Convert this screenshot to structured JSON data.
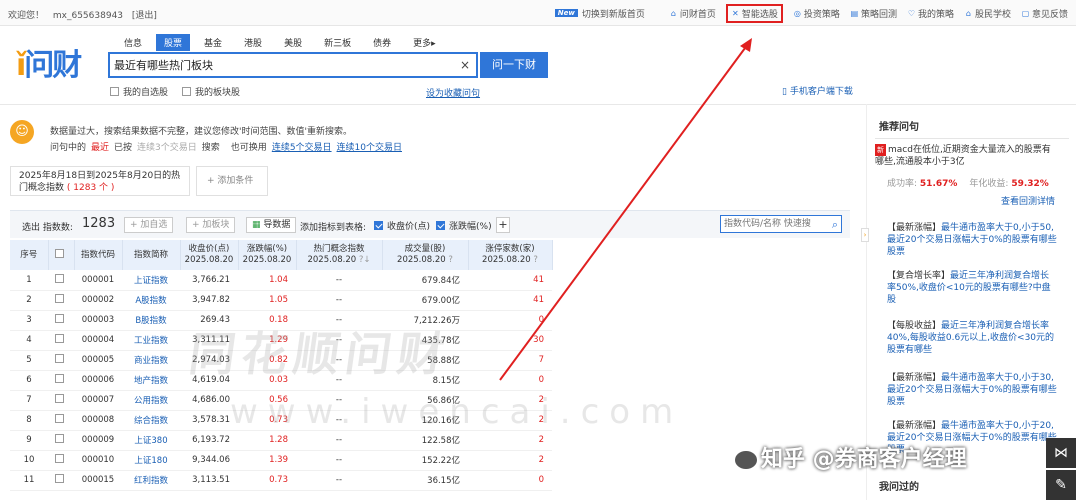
{
  "topbar": {
    "welcome": "欢迎您！",
    "user": "mx_655638943",
    "logout": "[退出]",
    "new_badge": "New",
    "switch_new": "切换到新版首页",
    "links": [
      "问财首页",
      "智能选股",
      "投资策略",
      "策略回测",
      "我的策略",
      "股民学校",
      "意见反馈"
    ]
  },
  "logo": {
    "text": "问财"
  },
  "tabs": [
    "信息",
    "股票",
    "基金",
    "港股",
    "美股",
    "新三板",
    "债券",
    "更多▸"
  ],
  "search": {
    "value": "最近有哪些热门板块",
    "clear": "×",
    "button": "问一下财"
  },
  "checks": {
    "my_stocks": "我的自选股",
    "my_sectors": "我的板块股"
  },
  "fav_link": "设为收藏问句",
  "mobile_link": "手机客户端下载",
  "notice": {
    "line1": "数据量过大，搜索结果数据不完整，建议您修改'时间范围、数值'重新搜索。",
    "l2_prefix": "问句中的",
    "l2_recent": "最近",
    "l2_mid": "已按",
    "l2_span": "连续3个交易日",
    "l2_search": "搜索",
    "l2_also": "也可换用",
    "l2_alt1": "连续5个交易日",
    "l2_alt2": "连续10个交易日"
  },
  "range": {
    "text": "2025年8月18日到2025年8月20日的热门概念指数",
    "count": "( 1283 个 )"
  },
  "add_condition": "+ 添加条件",
  "toolbar": {
    "selected_label": "选出 指数数:",
    "count": "1283",
    "add_watch": "+ 加自选",
    "add_sector": "+ 加板块",
    "export": "导数据",
    "add_col_label": "添加指标到表格:",
    "col1": "收盘价(点)",
    "col2": "涨跌幅(%)",
    "plus": "+",
    "quick_search_placeholder": "指数代码/名称 快速搜"
  },
  "table": {
    "headers": [
      [
        "序号"
      ],
      [
        "□"
      ],
      [
        "指数代码"
      ],
      [
        "指数简称"
      ],
      [
        "收盘价(点)",
        "2025.08.20"
      ],
      [
        "涨跌幅(%)",
        "2025.08.20"
      ],
      [
        "热门概念指数",
        "2025.08.20"
      ],
      [
        "成交量(股)",
        "2025.08.20"
      ],
      [
        "涨停家数(家)",
        "2025.08.20"
      ]
    ],
    "rows": [
      [
        "1",
        "000001",
        "上证指数",
        "3,766.21",
        "1.04",
        "--",
        "679.84亿",
        "41"
      ],
      [
        "2",
        "000002",
        "A股指数",
        "3,947.82",
        "1.05",
        "--",
        "679.00亿",
        "41"
      ],
      [
        "3",
        "000003",
        "B股指数",
        "269.43",
        "0.18",
        "--",
        "7,212.26万",
        "0"
      ],
      [
        "4",
        "000004",
        "工业指数",
        "3,311.11",
        "1.29",
        "--",
        "435.78亿",
        "30"
      ],
      [
        "5",
        "000005",
        "商业指数",
        "2,974.03",
        "0.82",
        "--",
        "58.88亿",
        "7"
      ],
      [
        "6",
        "000006",
        "地产指数",
        "4,619.04",
        "0.03",
        "--",
        "8.15亿",
        "0"
      ],
      [
        "7",
        "000007",
        "公用指数",
        "4,686.00",
        "0.56",
        "--",
        "56.86亿",
        "2"
      ],
      [
        "8",
        "000008",
        "综合指数",
        "3,578.31",
        "0.73",
        "--",
        "120.16亿",
        "2"
      ],
      [
        "9",
        "000009",
        "上证380",
        "6,193.72",
        "1.28",
        "--",
        "122.58亿",
        "2"
      ],
      [
        "10",
        "000010",
        "上证180",
        "9,344.06",
        "1.39",
        "--",
        "152.22亿",
        "2"
      ],
      [
        "11",
        "000015",
        "红利指数",
        "3,113.51",
        "0.73",
        "--",
        "36.15亿",
        "0"
      ]
    ]
  },
  "watermark": {
    "cn": "同花顺问财",
    "en": "www.iwencai.com"
  },
  "side": {
    "title": "推荐问句",
    "q1_tag": "新",
    "q1": "macd在低位,近期资金大量流入的股票有哪些,流通股本小于3亿",
    "rate_label": "成功率:",
    "rate": "51.67%",
    "annual_label": "年化收益:",
    "annual": "59.32%",
    "detail": "查看回测详情",
    "items": [
      {
        "tag": "【最新涨幅】",
        "text": "最牛通市盈率大于0,小于50,最近20个交易日涨幅大于0%的股票有哪些股票"
      },
      {
        "tag": "【复合增长率】",
        "text": "最近三年净利润复合增长率50%,收盘价<10元的股票有哪些?中盘股"
      },
      {
        "tag": "【每股收益】",
        "text": "最近三年净利润复合增长率40%,每股收益0.6元以上,收盘价<30元的股票有哪些"
      },
      {
        "tag": "【最新涨幅】",
        "text": "最牛通市盈率大于0,小于30,最近20个交易日涨幅大于0%的股票有哪些股票"
      },
      {
        "tag": "【最新涨幅】",
        "text": "最牛通市盈率大于0,小于20,最近20个交易日涨幅大于0%的股票有哪些股票"
      }
    ],
    "visited": "我问过的"
  },
  "overlay": {
    "zhihu": "知乎 @券商客户经理"
  }
}
